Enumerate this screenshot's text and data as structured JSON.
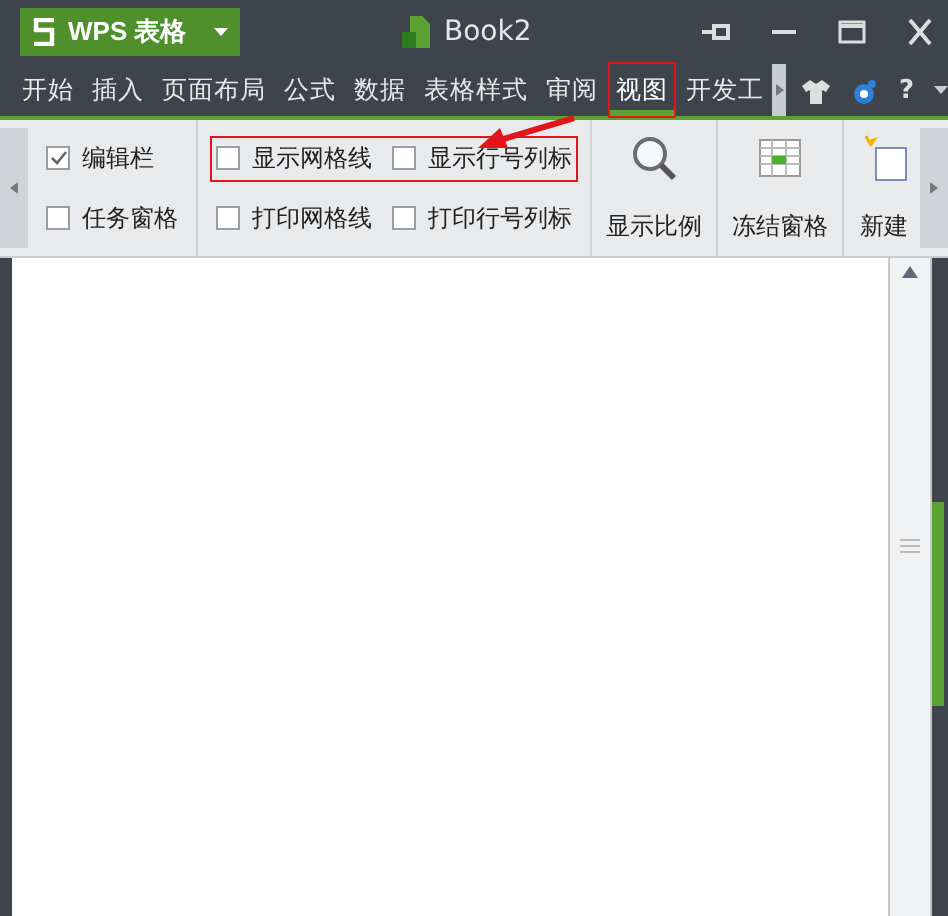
{
  "app_menu": {
    "label": "WPS 表格"
  },
  "title": "Book2",
  "menu_tabs": [
    {
      "label": "开始",
      "selected": false,
      "highlighted": false
    },
    {
      "label": "插入",
      "selected": false,
      "highlighted": false
    },
    {
      "label": "页面布局",
      "selected": false,
      "highlighted": false
    },
    {
      "label": "公式",
      "selected": false,
      "highlighted": false
    },
    {
      "label": "数据",
      "selected": false,
      "highlighted": false
    },
    {
      "label": "表格样式",
      "selected": false,
      "highlighted": false
    },
    {
      "label": "审阅",
      "selected": false,
      "highlighted": false
    },
    {
      "label": "视图",
      "selected": true,
      "highlighted": true
    },
    {
      "label": "开发工",
      "selected": false,
      "highlighted": false
    }
  ],
  "help": "?",
  "ribbon": {
    "check_groups": [
      {
        "rows": [
          {
            "highlighted": false,
            "items": [
              {
                "label": "编辑栏",
                "checked": true
              }
            ]
          },
          {
            "highlighted": false,
            "items": [
              {
                "label": "任务窗格",
                "checked": false
              }
            ]
          }
        ]
      },
      {
        "rows": [
          {
            "highlighted": true,
            "items": [
              {
                "label": "显示网格线",
                "checked": false
              },
              {
                "label": "显示行号列标",
                "checked": false
              }
            ]
          },
          {
            "highlighted": false,
            "items": [
              {
                "label": "打印网格线",
                "checked": false
              },
              {
                "label": "打印行号列标",
                "checked": false
              }
            ]
          }
        ]
      }
    ],
    "buttons": [
      {
        "label": "显示比例",
        "kind": "zoom"
      },
      {
        "label": "冻结窗格",
        "kind": "freeze"
      },
      {
        "label": "新建",
        "kind": "new"
      }
    ]
  }
}
